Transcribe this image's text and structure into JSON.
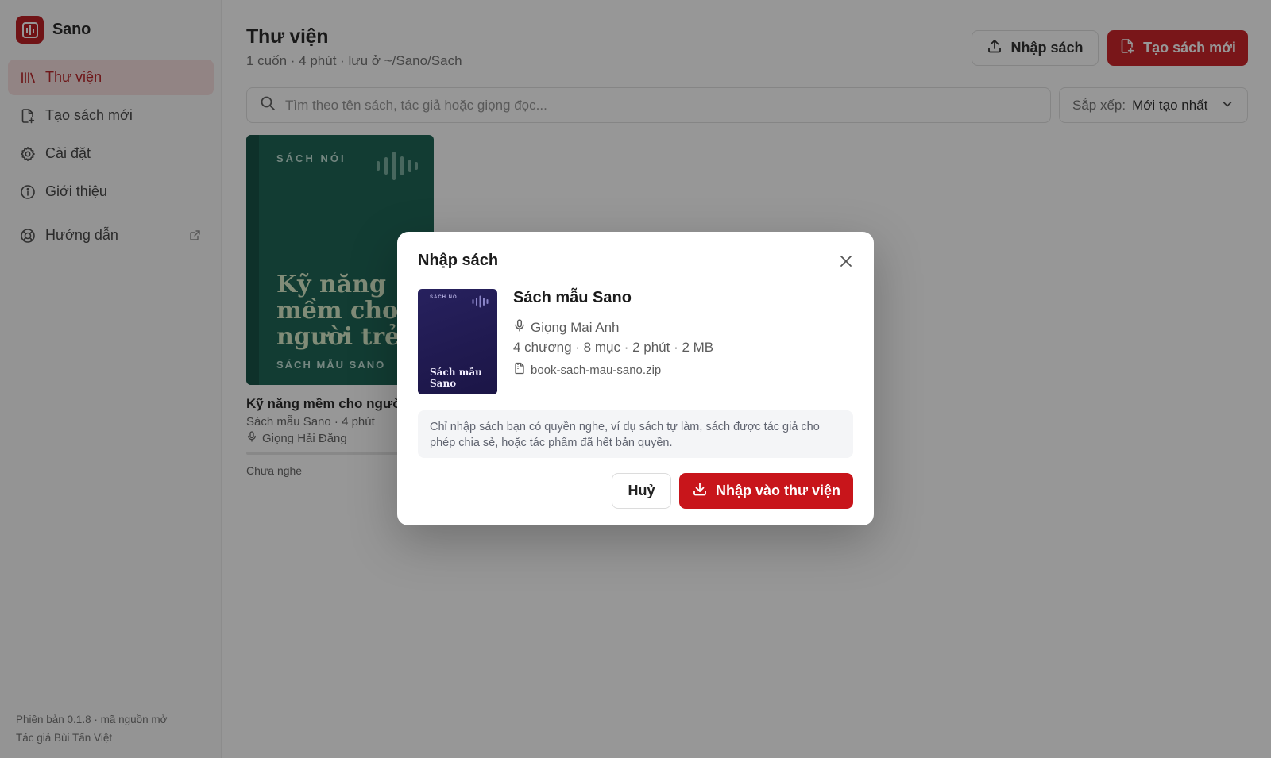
{
  "app": {
    "name": "Sano"
  },
  "sidebar": {
    "items": [
      {
        "label": "Thư viện",
        "icon": "library-icon",
        "active": true
      },
      {
        "label": "Tạo sách mới",
        "icon": "new-file-icon"
      },
      {
        "label": "Cài đặt",
        "icon": "gear-icon"
      },
      {
        "label": "Giới thiệu",
        "icon": "info-icon"
      },
      {
        "label": "Hướng dẫn",
        "icon": "lifebuoy-icon",
        "external": true
      }
    ],
    "footer": {
      "version": "Phiên bản 0.1.8 · mã nguồn mở",
      "author": "Tác giả Bùi Tấn Việt"
    }
  },
  "header": {
    "title": "Thư viện",
    "subtitle": "1 cuốn · 4 phút · lưu ở ~/Sano/Sach",
    "import_label": "Nhập sách",
    "create_label": "Tạo sách mới"
  },
  "search": {
    "placeholder": "Tìm theo tên sách, tác giả hoặc giọng đọc...",
    "value": ""
  },
  "sort": {
    "label": "Sắp xếp:",
    "value": "Mới tạo nhất"
  },
  "books": [
    {
      "cover_tag": "SÁCH NÓI",
      "cover_title": "Kỹ năng mềm cho người trẻ",
      "cover_author": "SÁCH MẪU SANO",
      "title": "Kỹ năng mềm cho người trẻ",
      "meta": "Sách mẫu Sano · 4 phút",
      "voice": "Giọng Hải Đăng",
      "status": "Chưa nghe",
      "progress": 0,
      "cover_color": "#0d5a4a"
    }
  ],
  "modal": {
    "title": "Nhập sách",
    "cover_tag": "SÁCH NÓI",
    "cover_title": "Sách mẫu Sano",
    "book_title": "Sách mẫu Sano",
    "voice": "Giọng Mai Anh",
    "stats": "4 chương · 8 mục · 2 phút · 2 MB",
    "file": "book-sach-mau-sano.zip",
    "notice": "Chỉ nhập sách bạn có quyền nghe, ví dụ sách tự làm, sách được tác giả cho phép chia sẻ, hoặc tác phẩm đã hết bản quyền.",
    "cancel_label": "Huỷ",
    "confirm_label": "Nhập vào thư viện"
  },
  "colors": {
    "accent": "#c8151b",
    "active_bg": "#f6dcdc",
    "cover_green": "#0d5a4a",
    "cover_purple": "#27215e"
  }
}
